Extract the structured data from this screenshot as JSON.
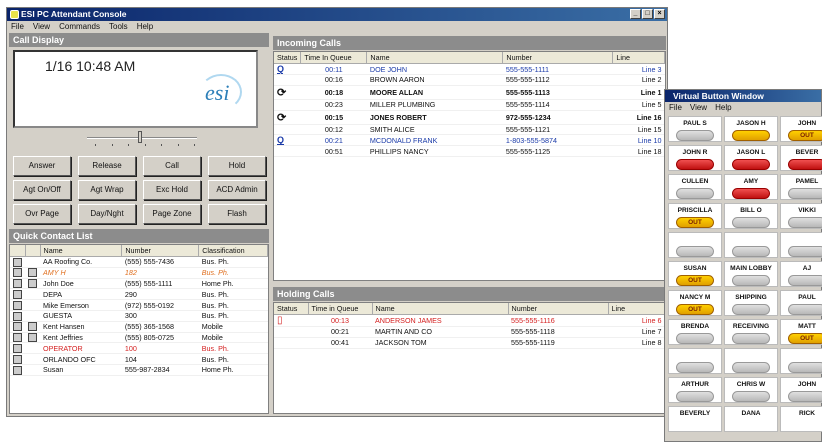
{
  "main_window": {
    "title": "ESI PC Attendant Console",
    "menu": [
      "File",
      "View",
      "Commands",
      "Tools",
      "Help"
    ]
  },
  "call_display": {
    "header": "Call Display",
    "datetime": "1/16 10:48 AM",
    "logo": "esi"
  },
  "buttons": [
    "Answer",
    "Release",
    "Call",
    "Hold",
    "Agt On/Off",
    "Agt Wrap",
    "Exc Hold",
    "ACD Admin",
    "Ovr Page",
    "Day/Nght",
    "Page Zone",
    "Flash"
  ],
  "quick_contacts": {
    "header": "Quick Contact List",
    "columns": [
      "",
      "",
      "Name",
      "Number",
      "Classification"
    ],
    "rows": [
      {
        "name": "AA Roofing Co.",
        "number": "(555) 555-7436",
        "class": "Bus. Ph.",
        "style": ""
      },
      {
        "name": "AMY H",
        "number": "182",
        "class": "Bus. Ph.",
        "style": "orange"
      },
      {
        "name": "John Doe",
        "number": "(555) 555-1111",
        "class": "Home Ph.",
        "style": ""
      },
      {
        "name": "DEPA",
        "number": "290",
        "class": "Bus. Ph.",
        "style": ""
      },
      {
        "name": "Mike Emerson",
        "number": "(972) 555-0192",
        "class": "Bus. Ph.",
        "style": ""
      },
      {
        "name": "GUESTA",
        "number": "300",
        "class": "Bus. Ph.",
        "style": ""
      },
      {
        "name": "Kent Hansen",
        "number": "(555) 365-1568",
        "class": "Mobile",
        "style": ""
      },
      {
        "name": "Kent Jeffries",
        "number": "(555) 805-0725",
        "class": "Mobile",
        "style": ""
      },
      {
        "name": "OPERATOR",
        "number": "100",
        "class": "Bus. Ph.",
        "style": "red"
      },
      {
        "name": "ORLANDO OFC",
        "number": "104",
        "class": "Bus. Ph.",
        "style": ""
      },
      {
        "name": "Susan",
        "number": "555-987-2834",
        "class": "Home Ph.",
        "style": ""
      }
    ]
  },
  "incoming_calls": {
    "header": "Incoming Calls",
    "columns": [
      "Status",
      "Time In Queue",
      "Name",
      "Number",
      "Line"
    ],
    "rows": [
      {
        "status": "Q",
        "time": "00:11",
        "name": "DOE JOHN",
        "number": "555-555-1111",
        "line": "Line 3",
        "style": "blue"
      },
      {
        "status": "",
        "time": "00:16",
        "name": "BROWN AARON",
        "number": "555-555-1112",
        "line": "Line 2",
        "style": ""
      },
      {
        "status": "ring",
        "time": "00:18",
        "name": "MOORE ALLAN",
        "number": "555-555-1113",
        "line": "Line 1",
        "style": "bold"
      },
      {
        "status": "",
        "time": "00:23",
        "name": "MILLER PLUMBING",
        "number": "555-555-1114",
        "line": "Line 5",
        "style": ""
      },
      {
        "status": "ring",
        "time": "00:15",
        "name": "JONES ROBERT",
        "number": "972-555-1234",
        "line": "Line 16",
        "style": "bold"
      },
      {
        "status": "",
        "time": "00:12",
        "name": "SMITH ALICE",
        "number": "555-555-1121",
        "line": "Line 15",
        "style": ""
      },
      {
        "status": "Q",
        "time": "00:21",
        "name": "MCDONALD FRANK",
        "number": "1-803-555-5874",
        "line": "Line 10",
        "style": "blue"
      },
      {
        "status": "",
        "time": "00:51",
        "name": "PHILLIPS NANCY",
        "number": "555-555-1125",
        "line": "Line 18",
        "style": ""
      }
    ]
  },
  "holding_calls": {
    "header": "Holding Calls",
    "columns": [
      "Status",
      "Time in Queue",
      "Name",
      "Number",
      "Line"
    ],
    "rows": [
      {
        "status": "hold",
        "time": "00:13",
        "name": "ANDERSON JAMES",
        "number": "555-555-1116",
        "line": "Line 6",
        "style": "red"
      },
      {
        "status": "",
        "time": "00:21",
        "name": "MARTIN AND CO",
        "number": "555-555-1118",
        "line": "Line 7",
        "style": ""
      },
      {
        "status": "",
        "time": "00:41",
        "name": "JACKSON TOM",
        "number": "555-555-1119",
        "line": "Line 8",
        "style": ""
      }
    ]
  },
  "virtual_buttons": {
    "title": "Virtual Button Window",
    "menu": [
      "File",
      "View",
      "Help"
    ],
    "buttons": [
      {
        "name": "PAUL S",
        "lamp": "off"
      },
      {
        "name": "JASON H",
        "lamp": "out_plain"
      },
      {
        "name": "JOHN",
        "lamp": "out",
        "label": "OUT"
      },
      {
        "name": "JOHN R",
        "lamp": "red"
      },
      {
        "name": "JASON L",
        "lamp": "red"
      },
      {
        "name": "BEVER",
        "lamp": "red"
      },
      {
        "name": "CULLEN",
        "lamp": "off"
      },
      {
        "name": "AMY",
        "lamp": "red"
      },
      {
        "name": "PAMEL",
        "lamp": "off"
      },
      {
        "name": "PRISCILLA",
        "lamp": "out",
        "label": "OUT"
      },
      {
        "name": "BILL O",
        "lamp": "off"
      },
      {
        "name": "VIKKI",
        "lamp": "off"
      },
      {
        "name": "",
        "lamp": "off"
      },
      {
        "name": "",
        "lamp": "off"
      },
      {
        "name": "",
        "lamp": "off"
      },
      {
        "name": "SUSAN",
        "lamp": "out",
        "label": "OUT"
      },
      {
        "name": "MAIN LOBBY",
        "lamp": "off"
      },
      {
        "name": "AJ",
        "lamp": "off"
      },
      {
        "name": "NANCY M",
        "lamp": "out",
        "label": "OUT"
      },
      {
        "name": "SHIPPING",
        "lamp": "off"
      },
      {
        "name": "PAUL",
        "lamp": "off"
      },
      {
        "name": "BRENDA",
        "lamp": "off"
      },
      {
        "name": "RECEIVING",
        "lamp": "off"
      },
      {
        "name": "MATT",
        "lamp": "out",
        "label": "OUT"
      },
      {
        "name": "",
        "lamp": "off"
      },
      {
        "name": "",
        "lamp": "off"
      },
      {
        "name": "",
        "lamp": "off"
      },
      {
        "name": "ARTHUR",
        "lamp": "off"
      },
      {
        "name": "CHRIS W",
        "lamp": "off"
      },
      {
        "name": "JOHN",
        "lamp": "off"
      },
      {
        "name": "BEVERLY",
        "lamp": "none"
      },
      {
        "name": "DANA",
        "lamp": "none"
      },
      {
        "name": "RICK",
        "lamp": "none"
      }
    ]
  },
  "colors": {
    "titlebar": "#0a246a",
    "blue_text": "#1a3aa8",
    "red_text": "#d42020",
    "lamp_red": "#d42020",
    "lamp_out": "#f0b800"
  }
}
